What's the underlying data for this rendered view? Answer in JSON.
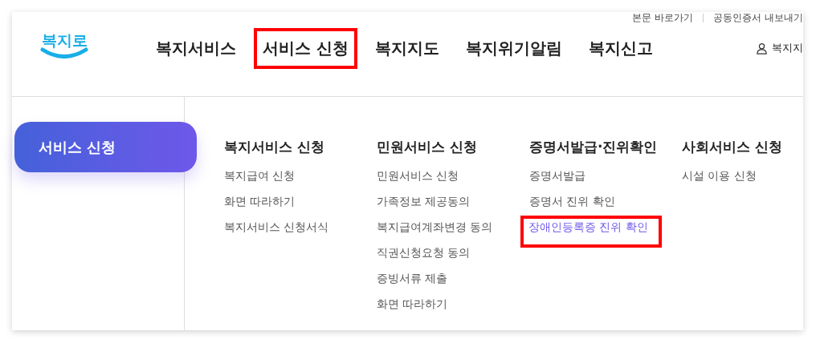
{
  "utility_links": [
    "본문 바로가기",
    "공동인증서 내보내기"
  ],
  "logo": {
    "text": "복지로"
  },
  "nav": [
    {
      "label": "복지서비스",
      "highlighted": false
    },
    {
      "label": "서비스 신청",
      "highlighted": true
    },
    {
      "label": "복지지도",
      "highlighted": false
    },
    {
      "label": "복지위기알림",
      "highlighted": false
    },
    {
      "label": "복지신고",
      "highlighted": false
    }
  ],
  "user_link": "복지지",
  "side_menu": {
    "label": "서비스 신청"
  },
  "columns": [
    {
      "heading": "복지서비스 신청",
      "items": [
        {
          "label": "복지급여 신청",
          "selected": false,
          "highlighted": false
        },
        {
          "label": "화면 따라하기",
          "selected": false,
          "highlighted": false
        },
        {
          "label": "복지서비스 신청서식",
          "selected": false,
          "highlighted": false
        }
      ]
    },
    {
      "heading": "민원서비스 신청",
      "items": [
        {
          "label": "민원서비스 신청",
          "selected": false,
          "highlighted": false
        },
        {
          "label": "가족정보 제공동의",
          "selected": false,
          "highlighted": false
        },
        {
          "label": "복지급여계좌변경 동의",
          "selected": false,
          "highlighted": false
        },
        {
          "label": "직권신청요청 동의",
          "selected": false,
          "highlighted": false
        },
        {
          "label": "증빙서류 제출",
          "selected": false,
          "highlighted": false
        },
        {
          "label": "화면 따라하기",
          "selected": false,
          "highlighted": false
        }
      ]
    },
    {
      "heading": "증명서발급·진위확인",
      "items": [
        {
          "label": "증명서발급",
          "selected": false,
          "highlighted": false
        },
        {
          "label": "증명서 진위 확인",
          "selected": false,
          "highlighted": false
        },
        {
          "label": "장애인등록증 진위 확인",
          "selected": true,
          "highlighted": true
        }
      ]
    },
    {
      "heading": "사회서비스 신청",
      "items": [
        {
          "label": "시설 이용 신청",
          "selected": false,
          "highlighted": false
        }
      ]
    }
  ]
}
